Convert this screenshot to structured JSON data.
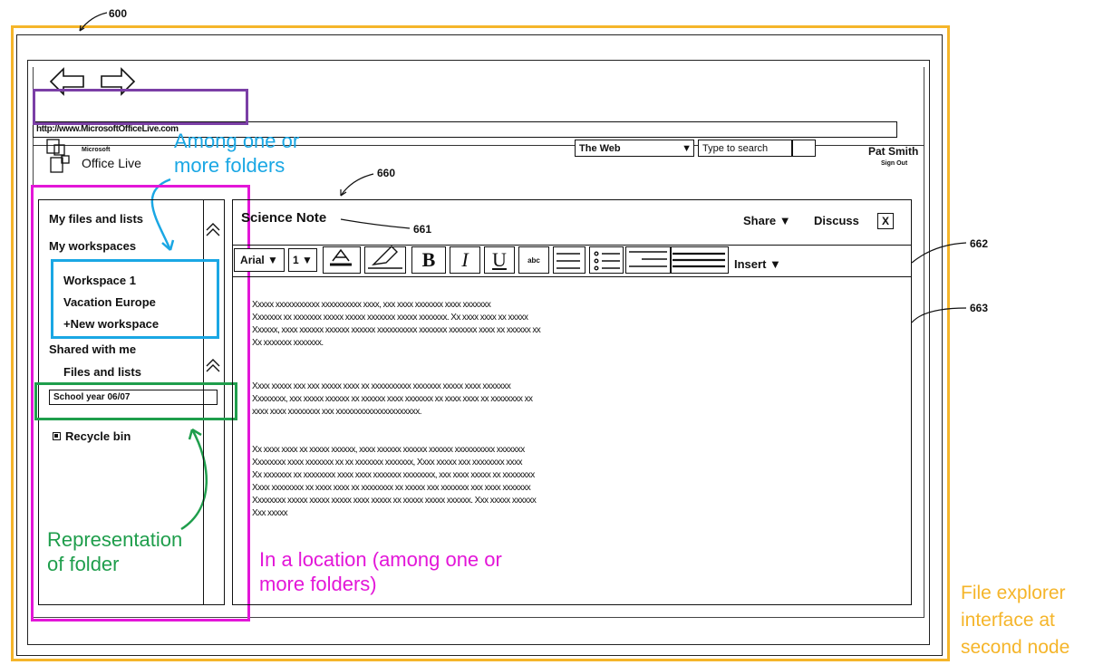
{
  "refs": {
    "r600": "600",
    "r660": "660",
    "r661": "661",
    "r662": "662",
    "r663": "663"
  },
  "browser": {
    "url": "http://www.MicrosoftOfficeLive.com"
  },
  "header": {
    "logo_small": "Microsoft",
    "logo_name": "Office Live",
    "scope_select": "The Web",
    "search_placeholder": "Type to search",
    "user_name": "Pat Smith",
    "sign_out": "Sign Out"
  },
  "sidebar": {
    "my_files": "My files and lists",
    "my_workspaces": "My workspaces",
    "workspaces": [
      "Workspace 1",
      "Vacation Europe",
      "+New workspace"
    ],
    "shared_with_me": "Shared with me",
    "files_and_lists": "Files and lists",
    "folder": "School year 06/07",
    "recycle_bin": "Recycle bin"
  },
  "document": {
    "title": "Science Note",
    "share": "Share ▼",
    "discuss": "Discuss",
    "close": "X",
    "toolbar": {
      "font": "Arial ▼",
      "size": "1 ▼",
      "bold": "B",
      "italic": "I",
      "underline": "U",
      "abc": "abc",
      "insert": "Insert ▼"
    },
    "paragraphs": [
      [
        "Xxxxx xxxxxxxxxxx xxxxxxxxxx xxxx, xxx xxxx xxxxxxx xxxx xxxxxxx",
        "Xxxxxxx xx xxxxxxx xxxxx xxxxx xxxxxxx xxxxx xxxxxxx.  Xx xxxx xxxx xx xxxxx",
        "Xxxxxx, xxxx xxxxxx xxxxxx xxxxxx xxxxxxxxxx xxxxxxx xxxxxxx xxxx xx xxxxxx xx",
        "Xx xxxxxxx xxxxxxx."
      ],
      [
        "Xxxx xxxxx xxx xxx xxxxx xxxx xx xxxxxxxxxx xxxxxxx xxxxx xxxx xxxxxxx",
        "Xxxxxxxx, xxx xxxxx xxxxxx xx xxxxxx xxxx xxxxxxx xx xxxx xxxx xx xxxxxxxx xx",
        "xxxx xxxx xxxxxxxx xxx xxxxxxxxxxxxxxxxxxxxx."
      ],
      [
        "Xx xxxx xxxx xx xxxxx xxxxxx, xxxx xxxxxx xxxxxx xxxxxx xxxxxxxxxx xxxxxxx",
        "Xxxxxxxx xxxx xxxxxxx xx xx xxxxxxx xxxxxxx, Xxxx xxxxx xxx xxxxxxxx xxxx",
        "Xx xxxxxxx xx xxxxxxxx xxxx xxxx xxxxxxx xxxxxxxx, xxx xxxx xxxxx xx xxxxxxxx",
        "Xxxx xxxxxxxx xx xxxx xxxx xx xxxxxxxx xx xxxxx xxx xxxxxxx xxx xxxx xxxxxxx",
        "Xxxxxxxx xxxxx xxxxx xxxxx xxxx xxxxx xx xxxxx xxxxx xxxxxx.  Xxx xxxxx xxxxxx",
        "Xxx xxxxx"
      ]
    ]
  },
  "annotations": {
    "folders": [
      "Among one or",
      "more folders"
    ],
    "representation": [
      "Representation",
      "of folder"
    ],
    "location": [
      "In a location (among one or",
      "more folders)"
    ],
    "explorer": [
      "File explorer",
      "interface at",
      "second node"
    ]
  },
  "colors": {
    "orange": "#f5b52a",
    "purple": "#7b3fa6",
    "cyan": "#1aa7e4",
    "green": "#1f9e4c",
    "magenta": "#e316d8"
  }
}
